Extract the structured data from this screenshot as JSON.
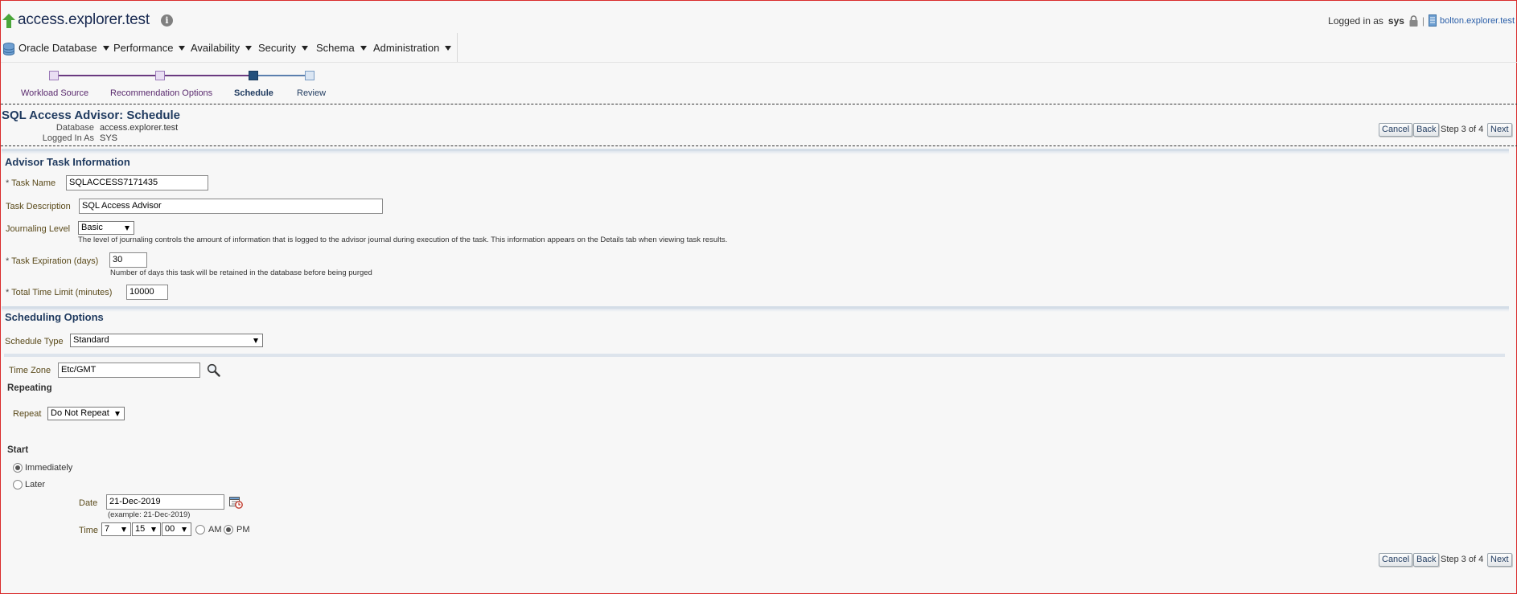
{
  "header": {
    "target_name": "access.explorer.test",
    "logged_in_prefix": "Logged in as",
    "user": "sys",
    "separator": "|",
    "host": "bolton.explorer.test"
  },
  "menu": [
    {
      "label": "Oracle Database"
    },
    {
      "label": "Performance"
    },
    {
      "label": "Availability"
    },
    {
      "label": "Security"
    },
    {
      "label": "Schema"
    },
    {
      "label": "Administration"
    }
  ],
  "train": {
    "steps": [
      {
        "label": "Workload Source"
      },
      {
        "label": "Recommendation Options"
      },
      {
        "label": "Schedule"
      },
      {
        "label": "Review"
      }
    ],
    "current_index": 2
  },
  "page": {
    "title": "SQL Access Advisor: Schedule",
    "database_label": "Database",
    "database_value": "access.explorer.test",
    "logged_in_as_label": "Logged In As",
    "logged_in_as_value": "SYS",
    "buttons": {
      "cancel": "Cancel",
      "back": "Back",
      "next": "Next"
    },
    "step_text": "Step 3 of 4"
  },
  "advisor_task": {
    "section_title": "Advisor Task Information",
    "task_name_label": "Task Name",
    "task_name_value": "SQLACCESS7171435",
    "task_description_label": "Task Description",
    "task_description_value": "SQL Access Advisor",
    "journaling_label": "Journaling Level",
    "journaling_value": "Basic",
    "journaling_hint": "The level of journaling controls the amount of information that is logged to the advisor journal during execution of the task. This information appears on the Details tab when viewing task results.",
    "expiration_label": "Task Expiration (days)",
    "expiration_value": "30",
    "expiration_hint": "Number of days this task will be retained in the database before being purged",
    "time_limit_label": "Total Time Limit (minutes)",
    "time_limit_value": "10000",
    "required_marker": "*"
  },
  "scheduling": {
    "section_title": "Scheduling Options",
    "schedule_type_label": "Schedule Type",
    "schedule_type_value": "Standard",
    "time_zone_label": "Time Zone",
    "time_zone_value": "Etc/GMT",
    "repeating_heading": "Repeating",
    "repeat_label": "Repeat",
    "repeat_value": "Do Not Repeat",
    "start_heading": "Start",
    "immediately_label": "Immediately",
    "later_label": "Later",
    "start_selected": "Immediately",
    "date_label": "Date",
    "date_value": "21-Dec-2019",
    "date_example": "(example: 21-Dec-2019)",
    "time_label": "Time",
    "hour": "7",
    "minute": "15",
    "second": "00",
    "am_label": "AM",
    "pm_label": "PM",
    "ampm_selected": "PM"
  },
  "colors": {
    "title": "#1f3a5f",
    "train_visited": "#5a2a6e",
    "train_current": "#1f4f7a",
    "link": "#2a5ea8",
    "frame_border": "#d92b2b"
  }
}
